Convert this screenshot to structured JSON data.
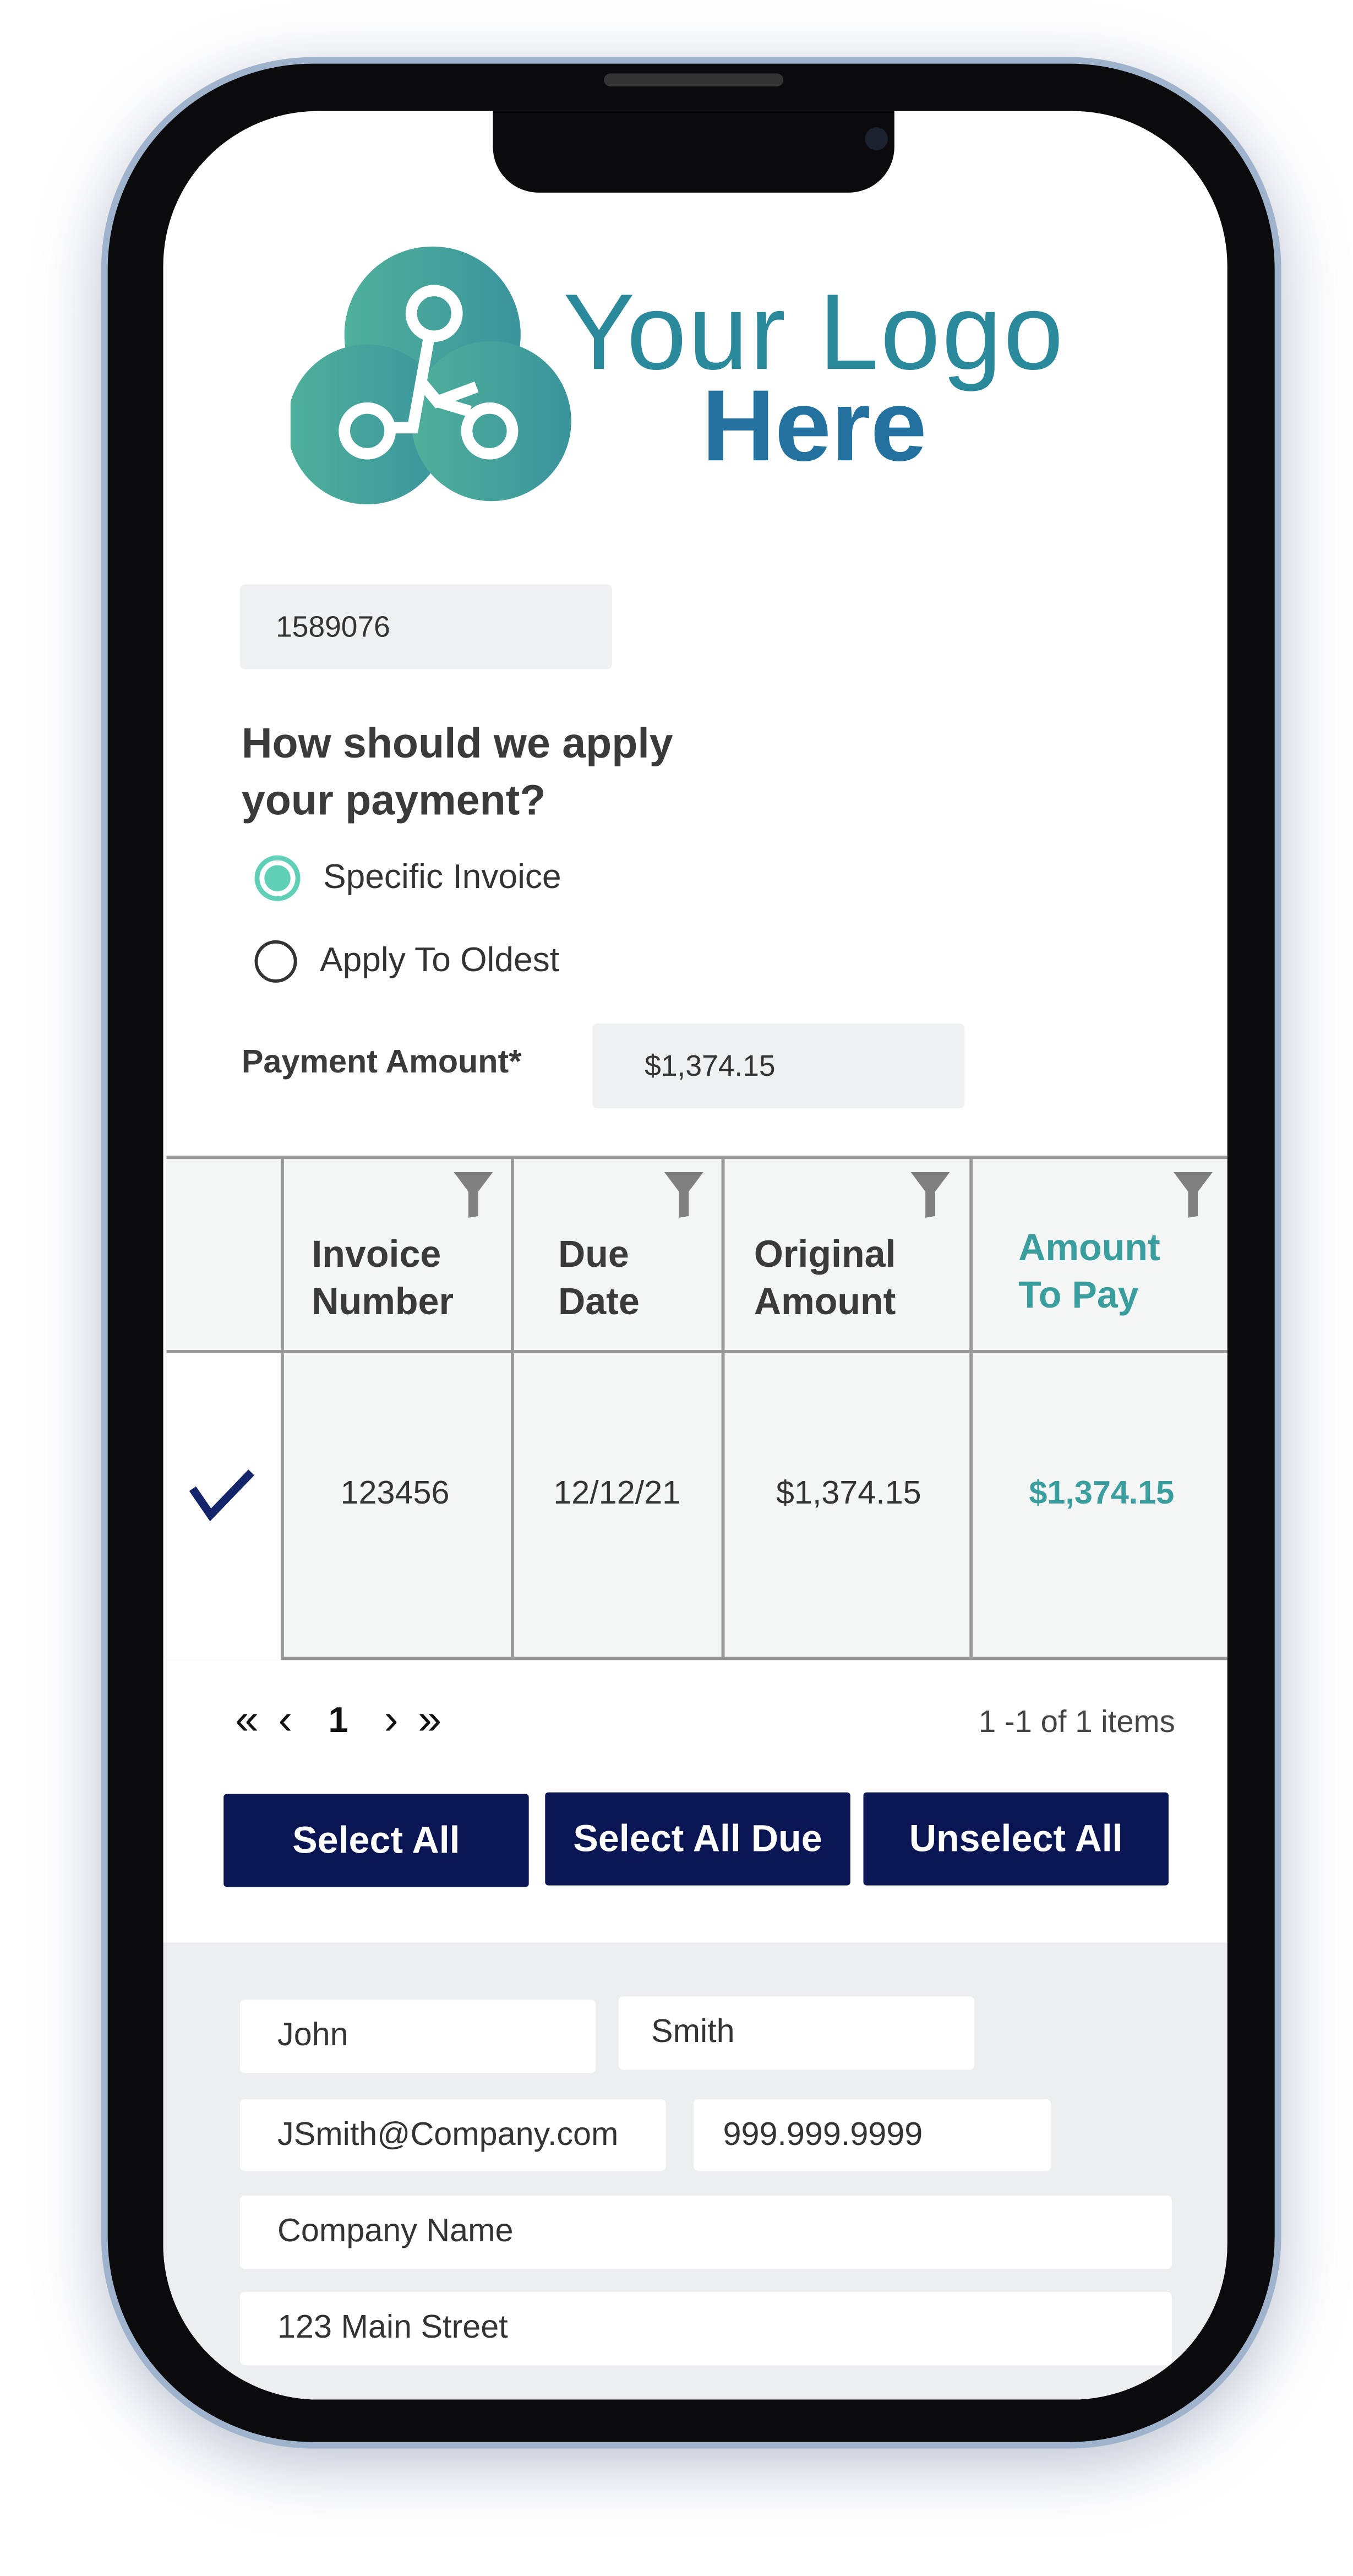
{
  "logo": {
    "line1": "Your Logo",
    "line2": "Here",
    "colors": [
      "#4fb09b",
      "#1a64a0"
    ]
  },
  "account_number": "1589076",
  "question": {
    "line1": "How should we apply",
    "line2": "your payment?"
  },
  "options": [
    {
      "label": "Specific Invoice",
      "selected": true
    },
    {
      "label": "Apply To Oldest",
      "selected": false
    }
  ],
  "payment_amount": {
    "label": "Payment Amount*",
    "value": "$1,374.15"
  },
  "table": {
    "headers": [
      {
        "line1": "Invoice",
        "line2": "Number"
      },
      {
        "line1": "Due",
        "line2": "Date"
      },
      {
        "line1": "Original",
        "line2": "Amount"
      },
      {
        "line1": "Amount",
        "line2": "To Pay"
      }
    ],
    "rows": [
      {
        "checked": true,
        "invoice_number": "123456",
        "due_date": "12/12/21",
        "original_amount": "$1,374.15",
        "amount_to_pay": "$1,374.15"
      }
    ]
  },
  "pagination": {
    "first": "«",
    "prev": "‹",
    "page": "1",
    "next": "›",
    "last": "»",
    "summary": "1 -1 of 1 items"
  },
  "buttons": {
    "select_all": "Select All",
    "select_all_due": "Select All Due",
    "unselect_all": "Unselect All"
  },
  "contact": {
    "first_name": "John",
    "last_name": "Smith",
    "email": "JSmith@Company.com",
    "phone": "999.999.9999",
    "company": "Company Name",
    "address": "123 Main Street"
  },
  "colors": {
    "accent": "#3a9e9e",
    "button": "#0a1654",
    "radio": "#5fcfb5",
    "check": "#13246b"
  }
}
